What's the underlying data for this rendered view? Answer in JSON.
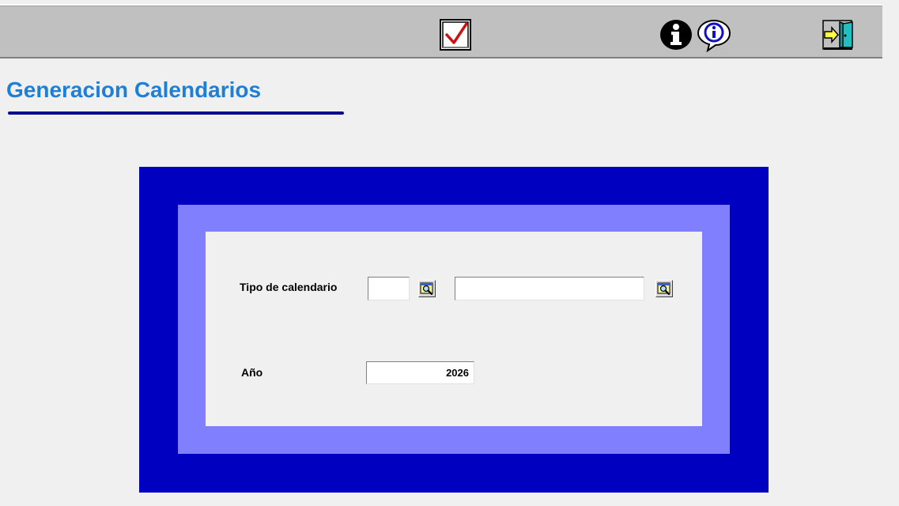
{
  "toolbar": {
    "buttons": [
      {
        "name": "accept-checkmark",
        "icon": "checkbox-check-icon"
      },
      {
        "name": "info",
        "icon": "info-icon"
      },
      {
        "name": "info-speech",
        "icon": "info-speech-icon"
      },
      {
        "name": "exit",
        "icon": "exit-door-icon"
      }
    ]
  },
  "page": {
    "title": "Generacion Calendarios"
  },
  "form": {
    "tipo_calendario": {
      "label": "Tipo de calendario",
      "code_value": "",
      "description_value": ""
    },
    "anio": {
      "label": "Año",
      "value": "2026"
    }
  },
  "colors": {
    "title": "#1e7fd6",
    "frame_outer": "#0000c0",
    "frame_mid": "#8080ff",
    "toolbar": "#c0c0c0"
  }
}
